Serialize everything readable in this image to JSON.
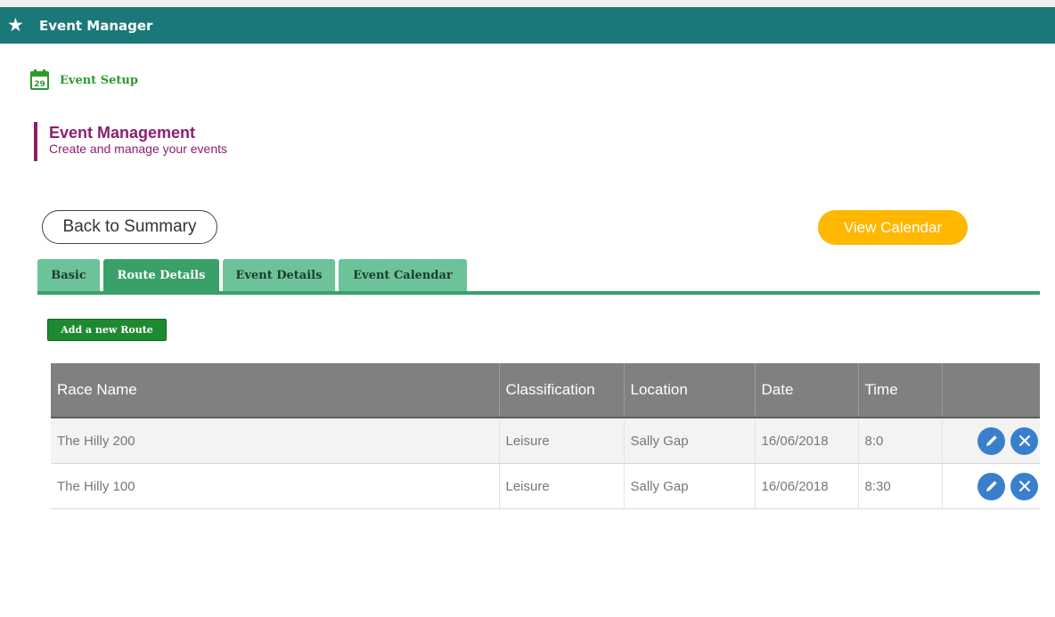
{
  "app": {
    "title": "Event Manager",
    "icon": "star-icon"
  },
  "breadcrumb": {
    "label": "Event Setup",
    "icon": "calendar-icon",
    "day": "29"
  },
  "section": {
    "title": "Event Management",
    "subtitle": "Create and manage your events"
  },
  "buttons": {
    "back": "Back to Summary",
    "calendar": "View Calendar",
    "add_route": "Add a new Route"
  },
  "tabs": [
    {
      "label": "Basic",
      "active": false
    },
    {
      "label": "Route Details",
      "active": true
    },
    {
      "label": "Event Details",
      "active": false
    },
    {
      "label": "Event Calendar",
      "active": false
    }
  ],
  "table": {
    "headers": [
      "Race Name",
      "Classification",
      "Location",
      "Date",
      "Time",
      ""
    ],
    "rows": [
      {
        "race": "The Hilly 200",
        "classification": "Leisure",
        "location": "Sally Gap",
        "date": "16/06/2018",
        "time": "8:0"
      },
      {
        "race": "The Hilly 100",
        "classification": "Leisure",
        "location": "Sally Gap",
        "date": "16/06/2018",
        "time": "8:30"
      }
    ]
  },
  "colors": {
    "appbar": "#1b7878",
    "breadcrumb_text": "#2e9a2e",
    "section_accent": "#8c1f70",
    "calendar_button": "#ffb700",
    "tab": "#6cc399",
    "tab_active": "#3aa06a",
    "add_button": "#1d8a30",
    "table_header": "#808080",
    "action_button": "#3a7fcc"
  }
}
